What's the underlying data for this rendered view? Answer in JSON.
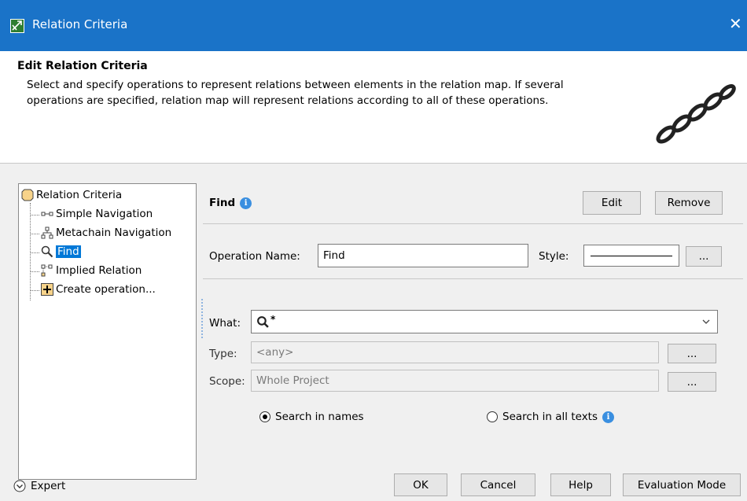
{
  "window": {
    "title": "Relation Criteria",
    "close_glyph": "✕"
  },
  "header": {
    "title": "Edit Relation Criteria",
    "description_line1": "Select and specify operations to represent relations between elements in the relation map. If several",
    "description_line2": "operations are specified, relation map will represent relations according to all of these operations."
  },
  "tree": {
    "root": {
      "label": "Relation Criteria",
      "icon": "relation-criteria-icon"
    },
    "items": [
      {
        "label": "Simple Navigation",
        "icon": "simple-navigation-icon"
      },
      {
        "label": "Metachain Navigation",
        "icon": "metachain-navigation-icon"
      },
      {
        "label": "Find",
        "icon": "find-icon",
        "selected": true
      },
      {
        "label": "Implied Relation",
        "icon": "implied-relation-icon"
      },
      {
        "label": "Create operation...",
        "icon": "add-icon"
      }
    ]
  },
  "panel": {
    "title": "Find",
    "edit_label": "Edit",
    "remove_label": "Remove",
    "operation_name_label": "Operation Name:",
    "operation_name_value": "Find",
    "style_label": "Style:",
    "ellipsis": "...",
    "what_label": "What:",
    "what_value": "*",
    "type_label": "Type:",
    "type_value": "<any>",
    "scope_label": "Scope:",
    "scope_value": "Whole Project",
    "search_names_label": "Search in names",
    "search_all_label": "Search in all texts",
    "search_mode": "names"
  },
  "footer": {
    "expert_label": "Expert",
    "ok_label": "OK",
    "cancel_label": "Cancel",
    "help_label": "Help",
    "evaluation_label": "Evaluation Mode"
  },
  "colors": {
    "titlebar": "#1a73c8",
    "selection": "#0078d7",
    "info": "#3a8fe0"
  }
}
